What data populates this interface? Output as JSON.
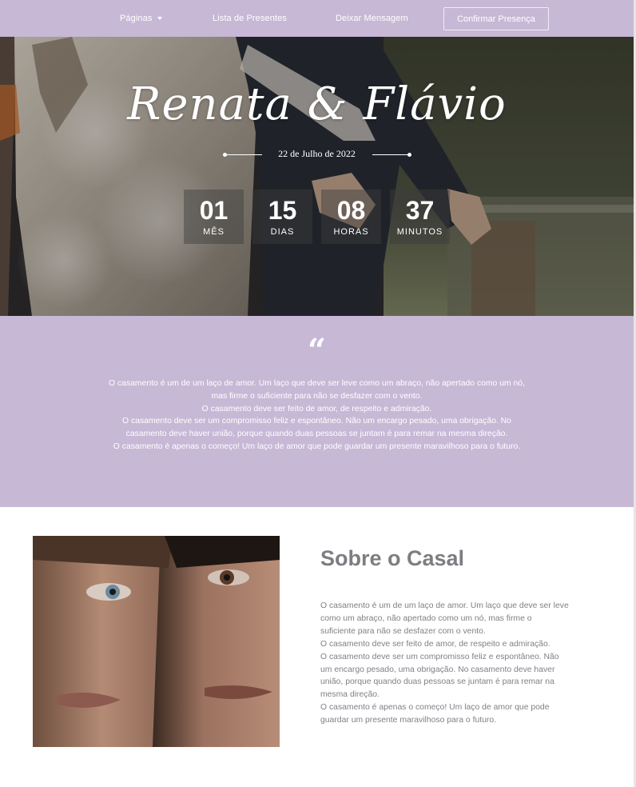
{
  "nav": {
    "items": [
      {
        "label": "Páginas",
        "has_dropdown": true
      },
      {
        "label": "Lista de Presentes",
        "has_dropdown": false
      },
      {
        "label": "Deixar Mensagem",
        "has_dropdown": false
      }
    ],
    "cta_label": "Confirmar Presença"
  },
  "hero": {
    "names": "Renata & Flávio",
    "date": "22 de Julho de 2022",
    "countdown": [
      {
        "value": "01",
        "label": "MÊS"
      },
      {
        "value": "15",
        "label": "DIAS"
      },
      {
        "value": "08",
        "label": "HORAS"
      },
      {
        "value": "37",
        "label": "MINUTOS"
      }
    ]
  },
  "quote": {
    "mark": "“",
    "lines": [
      "O casamento é um de um laço de amor. Um laço que deve ser leve como um abraço, não apertado como um nó,",
      "mas firme o suficiente para não se desfazer com o vento.",
      "O casamento deve ser feito de amor, de respeito e admiração.",
      "O casamento deve ser um compromisso feliz e espontâneo. Não um encargo pesado, uma obrigação. No",
      "casamento deve haver união, porque quando duas pessoas se juntam é para remar na mesma direção.",
      "O casamento é apenas o começo! Um laço de amor que pode guardar um presente maravilhoso para o futuro."
    ]
  },
  "about": {
    "title": "Sobre o Casal",
    "lines": [
      "O casamento é um de um laço de amor. Um laço que deve ser leve",
      "como um abraço, não apertado como um nó, mas firme o",
      "suficiente para não se desfazer com o vento.",
      "O casamento deve ser feito de amor, de respeito e admiração.",
      "O casamento deve ser um compromisso feliz e espontâneo. Não",
      "um encargo pesado, uma obrigação. No casamento deve haver",
      "união, porque quando duas pessoas se juntam é para remar na",
      "mesma direção.",
      "O casamento é apenas o começo! Um laço de amor que pode",
      "guardar um presente maravilhoso para o futuro."
    ]
  },
  "colors": {
    "brand_lilac": "#c7b8d6",
    "heading_gray": "#7d7d82",
    "body_gray": "#808088"
  }
}
